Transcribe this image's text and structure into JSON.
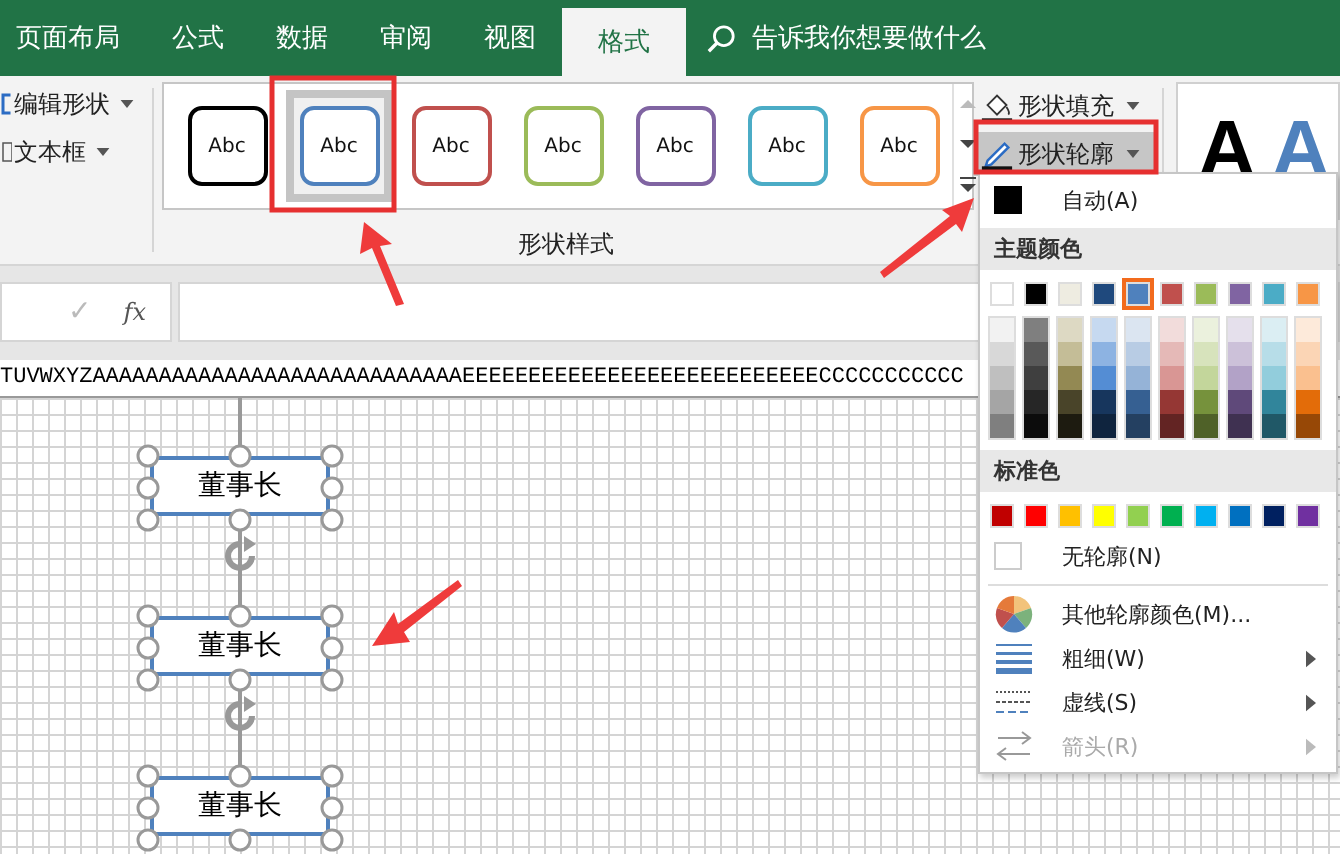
{
  "tabs": [
    {
      "label": "页面布局",
      "selected": false
    },
    {
      "label": "公式",
      "selected": false
    },
    {
      "label": "数据",
      "selected": false
    },
    {
      "label": "审阅",
      "selected": false
    },
    {
      "label": "视图",
      "selected": false
    },
    {
      "label": "格式",
      "selected": true
    }
  ],
  "tell_me": {
    "placeholder": "告诉我你想要做什么"
  },
  "ribbon": {
    "left_buttons": [
      {
        "label": "编辑形状",
        "kind": "edit"
      },
      {
        "label": "文本框",
        "kind": "textbox"
      }
    ],
    "styles_gallery": {
      "group_label": "形状样式",
      "items": [
        {
          "label": "Abc",
          "color": "#000000",
          "selected": false
        },
        {
          "label": "Abc",
          "color": "#4f81bd",
          "selected": true
        },
        {
          "label": "Abc",
          "color": "#c0504d",
          "selected": false
        },
        {
          "label": "Abc",
          "color": "#9bbb59",
          "selected": false
        },
        {
          "label": "Abc",
          "color": "#8064a2",
          "selected": false
        },
        {
          "label": "Abc",
          "color": "#4bacc6",
          "selected": false
        },
        {
          "label": "Abc",
          "color": "#f79646",
          "selected": false
        }
      ]
    },
    "shape_buttons": [
      {
        "label": "形状填充",
        "kind": "fill",
        "highlighted": false
      },
      {
        "label": "形状轮廓",
        "kind": "outline",
        "highlighted": true
      }
    ],
    "wordart": [
      {
        "label": "A",
        "color": "#000000"
      },
      {
        "label": "A",
        "color": "#4f81bd"
      }
    ]
  },
  "formula_bar": {
    "enter": "✓",
    "function": "fx"
  },
  "column_header": "TUVWXYZAAAAAAAAAAAAAAAAAAAAAAAAAAAAEEEEEEEEEEEEEEEEEEEEEEEEEEECCCCCCCCCCC",
  "shapes": [
    {
      "label": "董事长",
      "selected": true
    },
    {
      "label": "董事长",
      "selected": true
    },
    {
      "label": "董事长",
      "selected": true
    }
  ],
  "outline_menu": {
    "auto": {
      "label": "自动(A)",
      "color": "#000000"
    },
    "theme_header": "主题颜色",
    "theme_colors": [
      {
        "color": "#ffffff",
        "selected": false,
        "shades": [
          {
            "color": "#f2f2f2"
          },
          {
            "color": "#d8d8d8"
          },
          {
            "color": "#bfbfbf"
          },
          {
            "color": "#a5a5a5"
          },
          {
            "color": "#7f7f7f"
          }
        ]
      },
      {
        "color": "#000000",
        "selected": false,
        "shades": [
          {
            "color": "#7f7f7f"
          },
          {
            "color": "#595959"
          },
          {
            "color": "#3f3f3f"
          },
          {
            "color": "#262626"
          },
          {
            "color": "#0c0c0c"
          }
        ]
      },
      {
        "color": "#eeece1",
        "selected": false,
        "shades": [
          {
            "color": "#ddd9c3"
          },
          {
            "color": "#c4bd97"
          },
          {
            "color": "#938953"
          },
          {
            "color": "#494429"
          },
          {
            "color": "#1d1b10"
          }
        ]
      },
      {
        "color": "#1f497d",
        "selected": false,
        "shades": [
          {
            "color": "#c6d9f0"
          },
          {
            "color": "#8db3e2"
          },
          {
            "color": "#548dd4"
          },
          {
            "color": "#17365d"
          },
          {
            "color": "#0f243e"
          }
        ]
      },
      {
        "color": "#4f81bd",
        "selected": true,
        "shades": [
          {
            "color": "#dbe5f1"
          },
          {
            "color": "#b8cce4"
          },
          {
            "color": "#95b3d7"
          },
          {
            "color": "#366092"
          },
          {
            "color": "#244061"
          }
        ]
      },
      {
        "color": "#c0504d",
        "selected": false,
        "shades": [
          {
            "color": "#f2dcdb"
          },
          {
            "color": "#e5b9b7"
          },
          {
            "color": "#d99694"
          },
          {
            "color": "#953734"
          },
          {
            "color": "#632423"
          }
        ]
      },
      {
        "color": "#9bbb59",
        "selected": false,
        "shades": [
          {
            "color": "#ebf1dd"
          },
          {
            "color": "#d7e3bc"
          },
          {
            "color": "#c3d69b"
          },
          {
            "color": "#76923c"
          },
          {
            "color": "#4f6128"
          }
        ]
      },
      {
        "color": "#8064a2",
        "selected": false,
        "shades": [
          {
            "color": "#e5e0ec"
          },
          {
            "color": "#ccc1d9"
          },
          {
            "color": "#b2a2c7"
          },
          {
            "color": "#5f497a"
          },
          {
            "color": "#3f3151"
          }
        ]
      },
      {
        "color": "#4bacc6",
        "selected": false,
        "shades": [
          {
            "color": "#dbeef3"
          },
          {
            "color": "#b7dde8"
          },
          {
            "color": "#92cddc"
          },
          {
            "color": "#31859b"
          },
          {
            "color": "#205867"
          }
        ]
      },
      {
        "color": "#f79646",
        "selected": false,
        "shades": [
          {
            "color": "#fdeada"
          },
          {
            "color": "#fbd5b5"
          },
          {
            "color": "#fac08f"
          },
          {
            "color": "#e36c09"
          },
          {
            "color": "#974806"
          }
        ]
      }
    ],
    "standard_header": "标准色",
    "standard_colors": [
      {
        "color": "#c00000"
      },
      {
        "color": "#ff0000"
      },
      {
        "color": "#ffc000"
      },
      {
        "color": "#ffff00"
      },
      {
        "color": "#92d050"
      },
      {
        "color": "#00b050"
      },
      {
        "color": "#00b0f0"
      },
      {
        "color": "#0070c0"
      },
      {
        "color": "#002060"
      },
      {
        "color": "#7030a0"
      }
    ],
    "items": [
      {
        "label": "无轮廓(N)",
        "kind": "none",
        "submenu": false,
        "disabled": false
      },
      {
        "label": "其他轮廓颜色(M)...",
        "kind": "more",
        "submenu": false,
        "disabled": false
      },
      {
        "label": "粗细(W)",
        "kind": "weight",
        "submenu": true,
        "disabled": false
      },
      {
        "label": "虚线(S)",
        "kind": "dash",
        "submenu": true,
        "disabled": false
      },
      {
        "label": "箭头(R)",
        "kind": "arrow",
        "submenu": true,
        "disabled": true
      }
    ]
  }
}
